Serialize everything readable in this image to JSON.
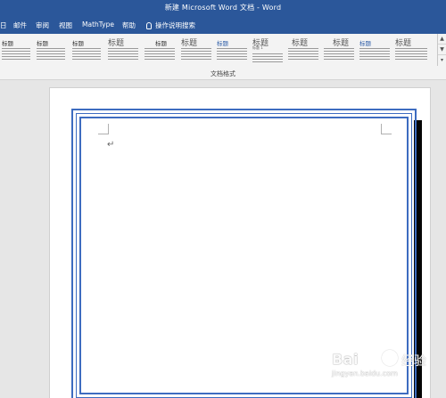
{
  "window": {
    "title": "新建 Microsoft Word 文档 - Word"
  },
  "tabs": [
    "日",
    "邮件",
    "审阅",
    "视图",
    "MathType",
    "帮助"
  ],
  "search": {
    "label": "操作说明搜索",
    "icon": "lightbulb-icon"
  },
  "styles_gallery": {
    "group_label": "文档格式",
    "items": [
      {
        "heading": "标题",
        "size": "mid"
      },
      {
        "heading": "标题",
        "size": "mid"
      },
      {
        "heading": "标题",
        "size": "mid"
      },
      {
        "heading": "标题",
        "size": "big"
      },
      {
        "heading": "标题",
        "size": "mid"
      },
      {
        "heading": "标题",
        "size": "big"
      },
      {
        "heading": "标题",
        "size": "mid"
      },
      {
        "heading": "标题",
        "size": "big"
      },
      {
        "heading": "标题",
        "size": "big"
      },
      {
        "heading": "标题",
        "size": "big"
      },
      {
        "heading": "标题",
        "size": "mid"
      },
      {
        "heading": "标题",
        "size": "big"
      }
    ],
    "sub_label": "标题 1"
  },
  "document": {
    "paragraph_mark": "↵",
    "border_color": "#3d6cc0"
  },
  "watermark": {
    "brand": "Bai",
    "brand_cn": "经验",
    "url": "jingyan.baidu.com"
  },
  "colors": {
    "titlebar": "#2b579a",
    "ribbon": "#f3f3f3",
    "canvas": "#e6e6e6"
  }
}
